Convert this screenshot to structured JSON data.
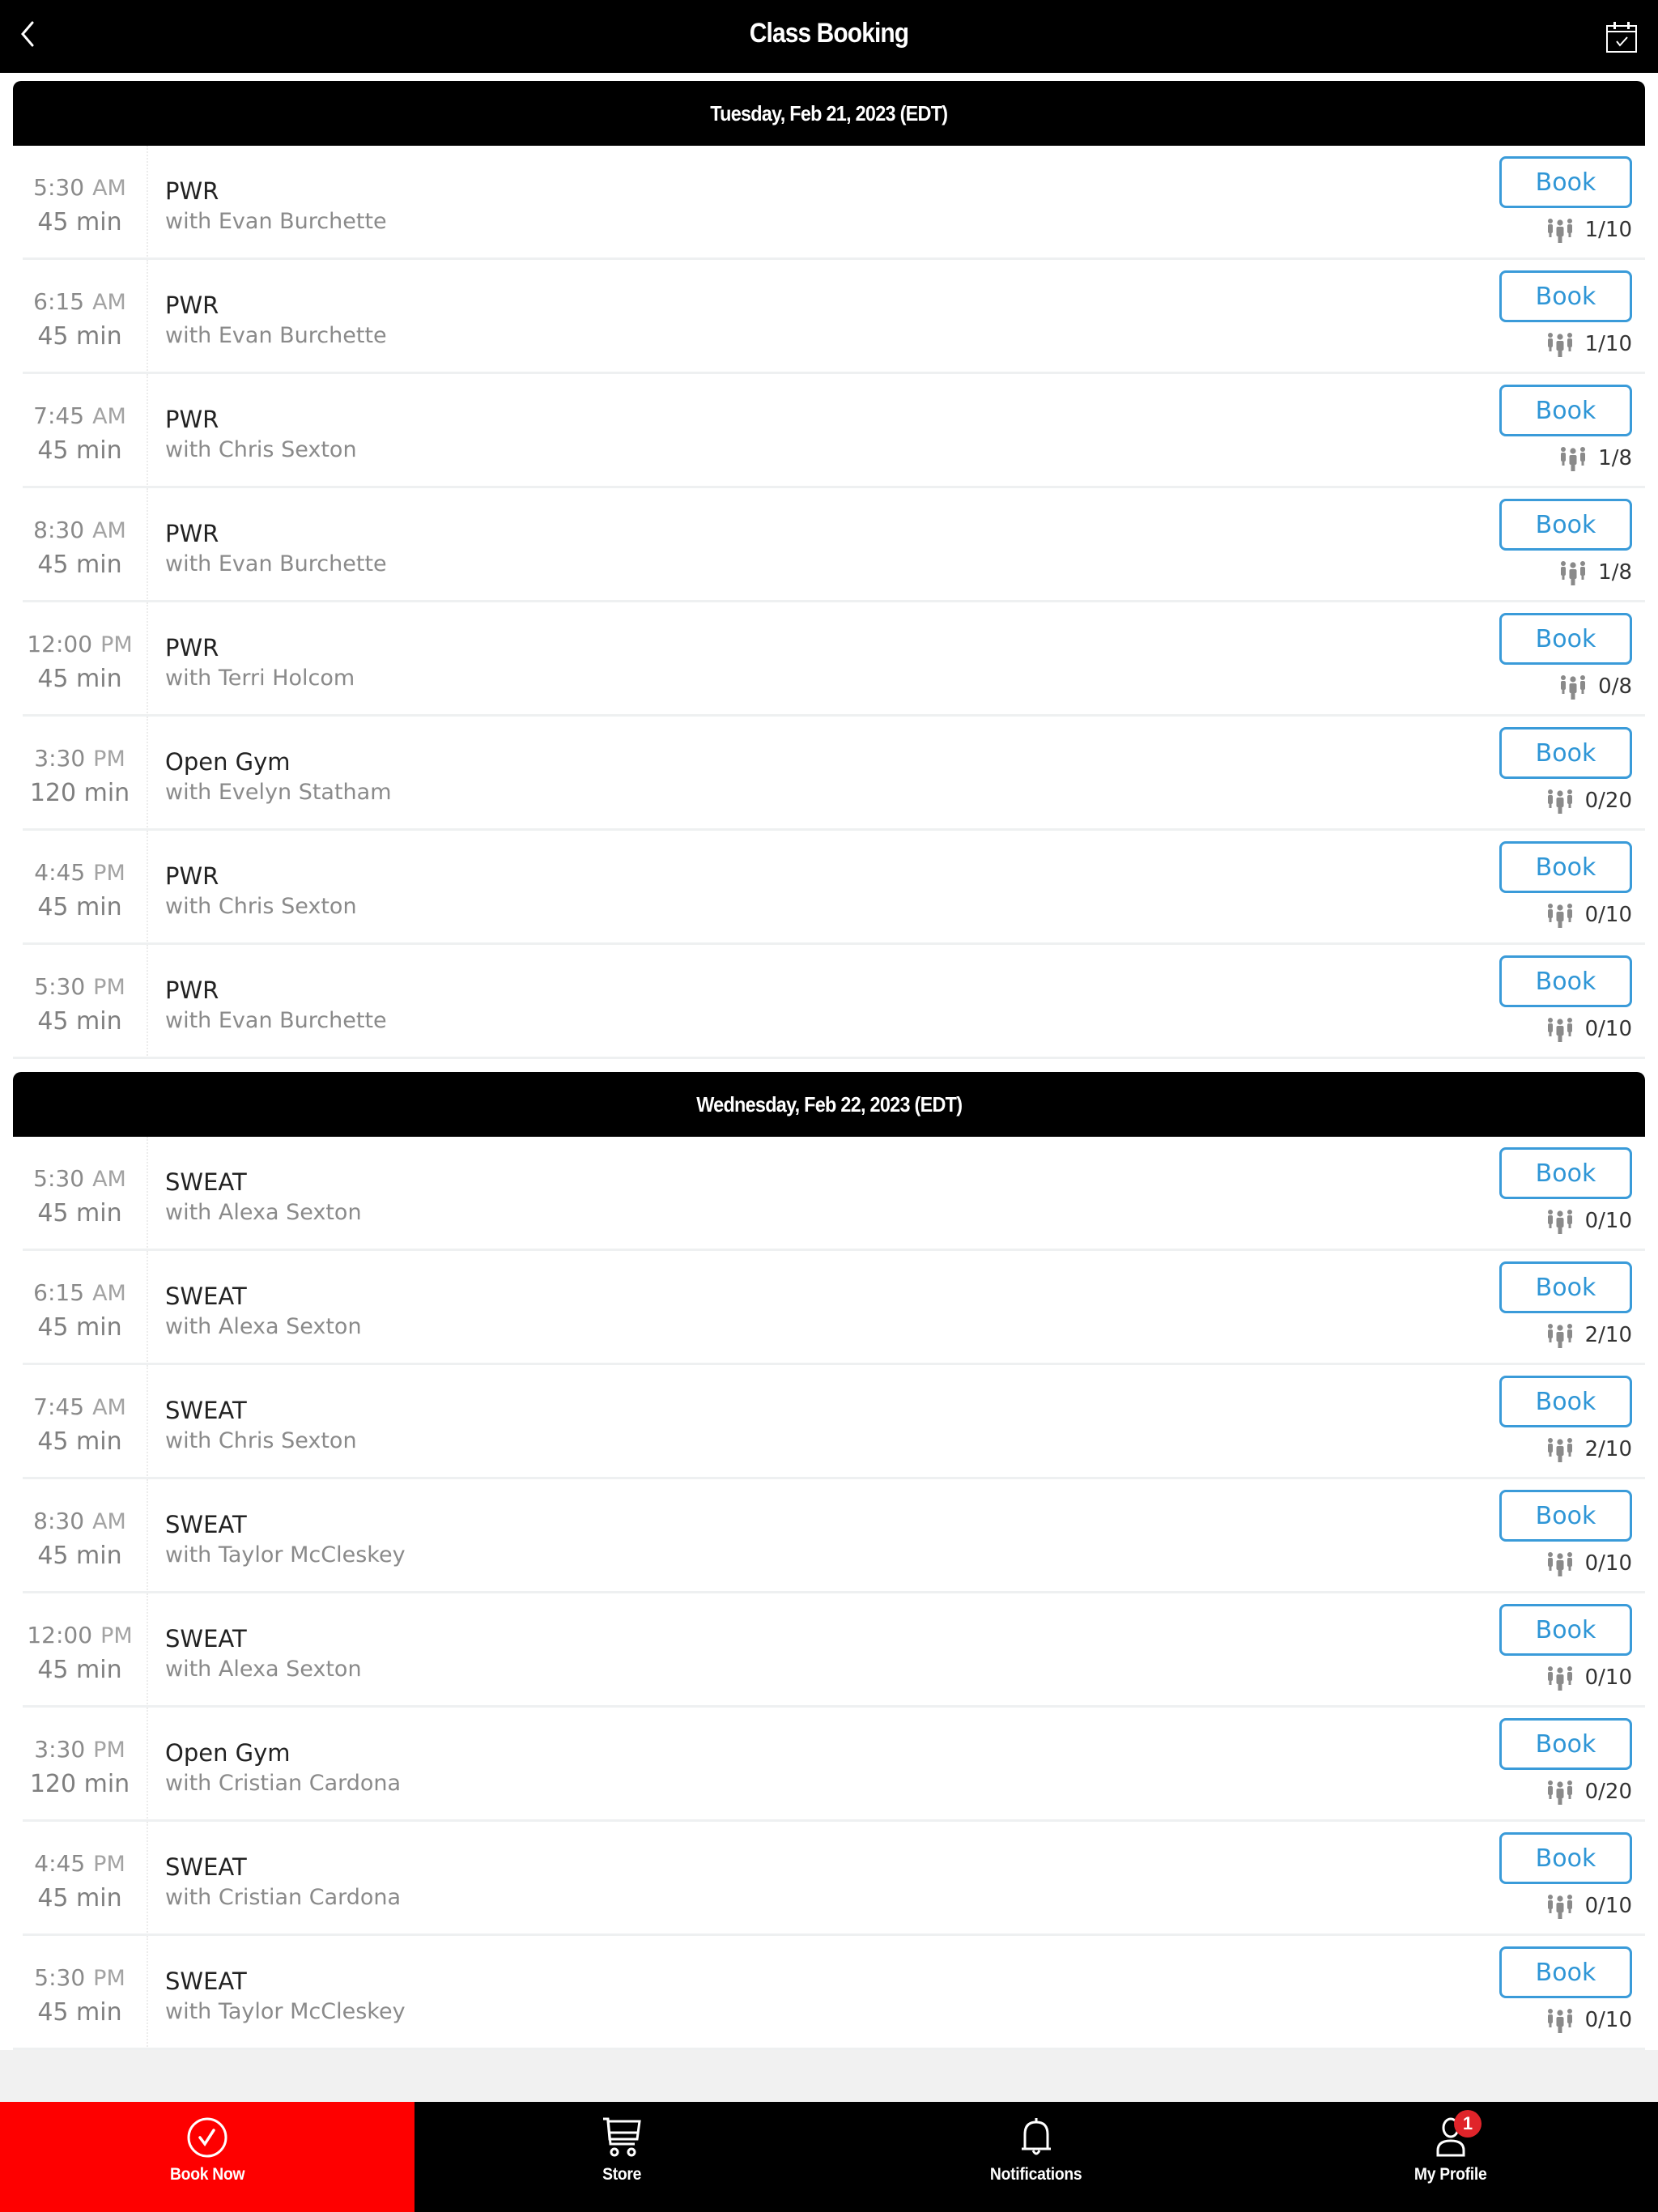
{
  "header": {
    "title": "Class Booking",
    "back_icon": "chevron-left-icon",
    "calendar_icon": "calendar-check-icon"
  },
  "days": [
    {
      "label": "Tuesday, Feb 21, 2023 (EDT)",
      "classes": [
        {
          "time": "5:30",
          "ampm": "AM",
          "duration": "45 min",
          "name": "PWR",
          "instructor": "with Evan Burchette",
          "book_label": "Book",
          "capacity": "1/10"
        },
        {
          "time": "6:15",
          "ampm": "AM",
          "duration": "45 min",
          "name": "PWR",
          "instructor": "with Evan Burchette",
          "book_label": "Book",
          "capacity": "1/10"
        },
        {
          "time": "7:45",
          "ampm": "AM",
          "duration": "45 min",
          "name": "PWR",
          "instructor": "with Chris Sexton",
          "book_label": "Book",
          "capacity": "1/8"
        },
        {
          "time": "8:30",
          "ampm": "AM",
          "duration": "45 min",
          "name": "PWR",
          "instructor": "with Evan Burchette",
          "book_label": "Book",
          "capacity": "1/8"
        },
        {
          "time": "12:00",
          "ampm": "PM",
          "duration": "45 min",
          "name": "PWR",
          "instructor": "with Terri Holcom",
          "book_label": "Book",
          "capacity": "0/8"
        },
        {
          "time": "3:30",
          "ampm": "PM",
          "duration": "120 min",
          "name": "Open Gym",
          "instructor": "with Evelyn Statham",
          "book_label": "Book",
          "capacity": "0/20"
        },
        {
          "time": "4:45",
          "ampm": "PM",
          "duration": "45 min",
          "name": "PWR",
          "instructor": "with Chris Sexton",
          "book_label": "Book",
          "capacity": "0/10"
        },
        {
          "time": "5:30",
          "ampm": "PM",
          "duration": "45 min",
          "name": "PWR",
          "instructor": "with Evan Burchette",
          "book_label": "Book",
          "capacity": "0/10"
        }
      ]
    },
    {
      "label": "Wednesday, Feb 22, 2023 (EDT)",
      "classes": [
        {
          "time": "5:30",
          "ampm": "AM",
          "duration": "45 min",
          "name": "SWEAT",
          "instructor": "with Alexa Sexton",
          "book_label": "Book",
          "capacity": "0/10"
        },
        {
          "time": "6:15",
          "ampm": "AM",
          "duration": "45 min",
          "name": "SWEAT",
          "instructor": "with Alexa Sexton",
          "book_label": "Book",
          "capacity": "2/10"
        },
        {
          "time": "7:45",
          "ampm": "AM",
          "duration": "45 min",
          "name": "SWEAT",
          "instructor": "with Chris Sexton",
          "book_label": "Book",
          "capacity": "2/10"
        },
        {
          "time": "8:30",
          "ampm": "AM",
          "duration": "45 min",
          "name": "SWEAT",
          "instructor": "with Taylor McCleskey",
          "book_label": "Book",
          "capacity": "0/10"
        },
        {
          "time": "12:00",
          "ampm": "PM",
          "duration": "45 min",
          "name": "SWEAT",
          "instructor": "with Alexa Sexton",
          "book_label": "Book",
          "capacity": "0/10"
        },
        {
          "time": "3:30",
          "ampm": "PM",
          "duration": "120 min",
          "name": "Open Gym",
          "instructor": "with Cristian Cardona",
          "book_label": "Book",
          "capacity": "0/20"
        },
        {
          "time": "4:45",
          "ampm": "PM",
          "duration": "45 min",
          "name": "SWEAT",
          "instructor": "with Cristian Cardona",
          "book_label": "Book",
          "capacity": "0/10"
        },
        {
          "time": "5:30",
          "ampm": "PM",
          "duration": "45 min",
          "name": "SWEAT",
          "instructor": "with Taylor McCleskey",
          "book_label": "Book",
          "capacity": "0/10"
        }
      ]
    }
  ],
  "bottom_nav": {
    "items": [
      {
        "label": "Book Now",
        "icon": "check-circle-icon",
        "active": true
      },
      {
        "label": "Store",
        "icon": "cart-icon",
        "active": false
      },
      {
        "label": "Notifications",
        "icon": "bell-icon",
        "active": false
      },
      {
        "label": "My Profile",
        "icon": "user-icon",
        "active": false,
        "badge": "1"
      }
    ]
  },
  "colors": {
    "accent_blue": "#2f96d6",
    "active_tab": "#fe0000",
    "badge": "#e0242a",
    "header_bg": "#000000"
  }
}
